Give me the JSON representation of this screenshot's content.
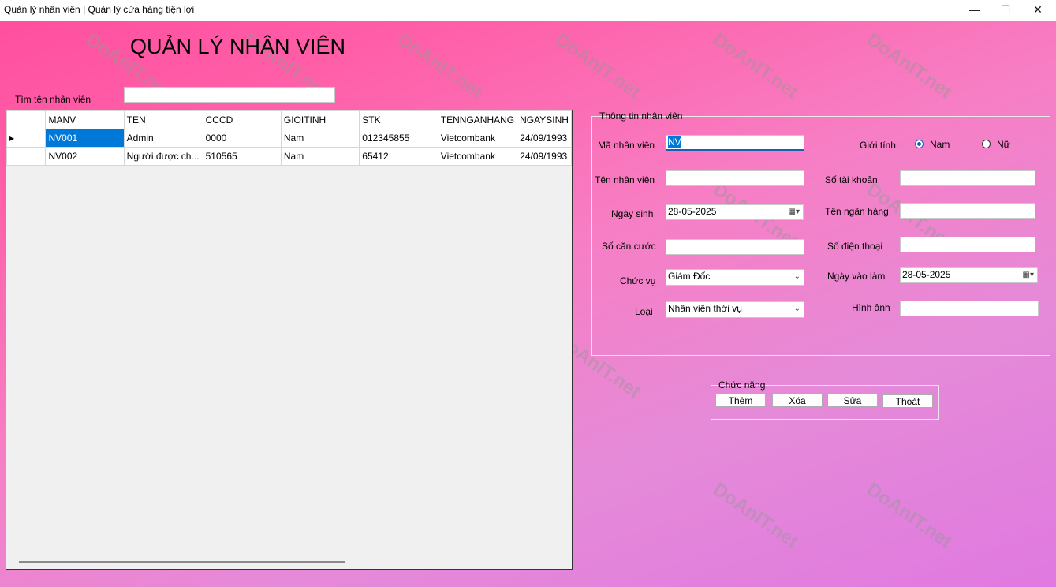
{
  "window": {
    "title": "Quản lý nhân viên | Quản lý cửa hàng tiện lợi",
    "minimize": "—",
    "maximize": "☐",
    "close": "✕"
  },
  "watermark": "DoAnIT.net",
  "page": {
    "heading": "QUẢN LÝ NHÂN VIÊN"
  },
  "search": {
    "label": "Tìm tên nhân viên",
    "value": ""
  },
  "grid": {
    "columns": [
      "MANV",
      "TEN",
      "CCCD",
      "GIOITINH",
      "STK",
      "TENNGANHANG",
      "NGAYSINH"
    ],
    "rows": [
      [
        "NV001",
        "Admin",
        "0000",
        "Nam",
        "012345855",
        "Vietcombank",
        "24/09/1993"
      ],
      [
        "NV002",
        "Người được ch...",
        "510565",
        "Nam",
        "65412",
        "Vietcombank",
        "24/09/1993"
      ]
    ],
    "row_indicator": "▸"
  },
  "info": {
    "group_title": "Thông tin nhân viên",
    "ma_label": "Mã nhân viên",
    "ma_value": "NV",
    "ten_label": "Tên nhân viên",
    "ten_value": "",
    "ngaysinh_label": "Ngày sinh",
    "ngaysinh_value": "28-05-2025",
    "cccd_label": "Số căn cước",
    "cccd_value": "",
    "chucvu_label": "Chức vụ",
    "chucvu_value": "Giám Đốc",
    "loai_label": "Loại",
    "loai_value": "Nhân viên thời vụ",
    "gioitinh_label": "Giới tính:",
    "nam_label": "Nam",
    "nu_label": "Nữ",
    "gioitinh_selected": "Nam",
    "stk_label": "Số tài khoản",
    "stk_value": "",
    "nganhang_label": "Tên ngân hàng",
    "nganhang_value": "",
    "sdt_label": "Số điện thoại",
    "sdt_value": "",
    "ngayvaolam_label": "Ngày vào làm",
    "ngayvaolam_value": "28-05-2025",
    "hinhanh_label": "Hình ảnh",
    "hinhanh_value": ""
  },
  "actions": {
    "group_title": "Chức năng",
    "them": "Thêm",
    "xoa": "Xóa",
    "sua": "Sửa",
    "thoat": "Thoát"
  }
}
